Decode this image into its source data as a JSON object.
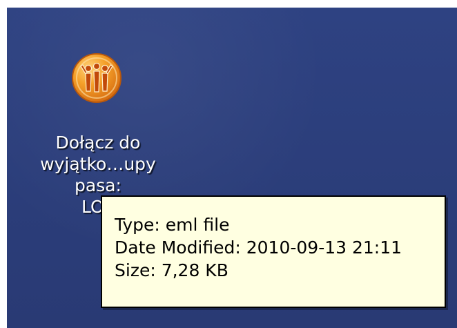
{
  "desktop_icon": {
    "name": "mail-shortcut",
    "label_lines": [
      "Dołącz do",
      "wyjątko…upy",
      "pasa:",
      "LOT"
    ]
  },
  "tooltip": {
    "type": "Type: eml file",
    "date_modified": "Date Modified: 2010-09-13 21:11",
    "size": "Size: 7,28 KB"
  },
  "colors": {
    "desktop_background": "#2b3e7a",
    "tooltip_background": "#ffffe1",
    "icon_orange": "#f08a1c"
  }
}
